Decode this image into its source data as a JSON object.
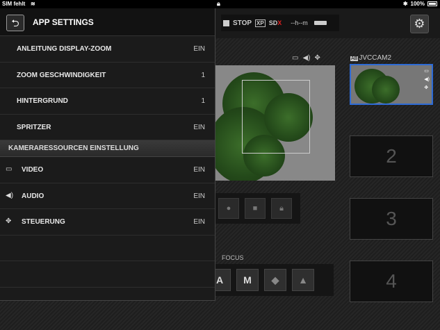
{
  "statusbar": {
    "carrier": "SIM fehlt",
    "battery": "100%"
  },
  "recorder": {
    "state": "STOP",
    "mode": "XP",
    "sd": "SD",
    "sd_x": "X",
    "time": "--h--m"
  },
  "main_view": {
    "focus_label": "FOCUS",
    "focus_auto": "A",
    "focus_manual": "M"
  },
  "side_panel": {
    "cam_tag": "AB",
    "cam_name": "JVCCAM2",
    "slots": [
      "2",
      "3",
      "4"
    ]
  },
  "settings": {
    "title": "APP SETTINGS",
    "rows": [
      {
        "label": "ANLEITUNG DISPLAY-ZOOM",
        "value": "EIN"
      },
      {
        "label": "ZOOM GESCHWINDIGKEIT",
        "value": "1"
      },
      {
        "label": "HINTERGRUND",
        "value": "1"
      },
      {
        "label": "SPRITZER",
        "value": "EIN"
      }
    ],
    "section_title": "KAMERARESSOURCEN EINSTELLUNG",
    "resource_rows": [
      {
        "icon": "video-icon",
        "label": "VIDEO",
        "value": "EIN"
      },
      {
        "icon": "audio-icon",
        "label": "AUDIO",
        "value": "EIN"
      },
      {
        "icon": "control-icon",
        "label": "STEUERUNG",
        "value": "EIN"
      }
    ]
  },
  "colors": {
    "accent_blue": "#2d6bd6",
    "sd_red": "#e02020"
  }
}
